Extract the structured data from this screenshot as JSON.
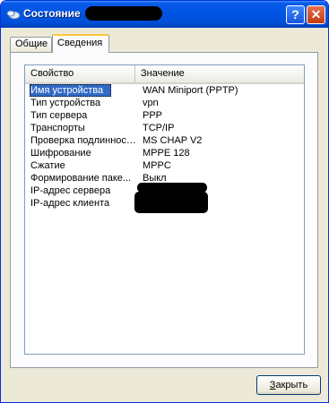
{
  "window": {
    "title": "Состояние"
  },
  "tabs": [
    {
      "label": "Общие"
    },
    {
      "label": "Сведения"
    }
  ],
  "list": {
    "columns": [
      "Свойство",
      "Значение"
    ],
    "rows": [
      {
        "property": "Имя устройства",
        "value": "WAN Miniport (PPTP)"
      },
      {
        "property": "Тип устройства",
        "value": "vpn"
      },
      {
        "property": "Тип сервера",
        "value": "PPP"
      },
      {
        "property": "Транспорты",
        "value": "TCP/IP"
      },
      {
        "property": "Проверка подлинности",
        "value": "MS CHAP V2"
      },
      {
        "property": "Шифрование",
        "value": "MPPE 128"
      },
      {
        "property": "Сжатие",
        "value": "MPPC"
      },
      {
        "property": "Формирование паке...",
        "value": "Выкл"
      },
      {
        "property": "IP-адрес сервера",
        "value": ""
      },
      {
        "property": "IP-адрес клиента",
        "value": ""
      }
    ]
  },
  "buttons": {
    "close_accel": "З",
    "close_rest": "акрыть"
  },
  "colors": {
    "titlebar": "#0054e3",
    "selection": "#316ac5",
    "active_tab_accent": "#ffc83c"
  }
}
